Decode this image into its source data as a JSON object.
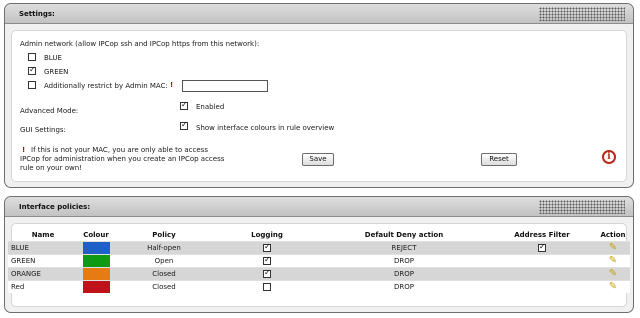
{
  "settings": {
    "title": "Settings:",
    "admin_network_label": "Admin network (allow IPCop ssh and IPCop https from this network):",
    "options": [
      {
        "label": "BLUE",
        "checked": false
      },
      {
        "label": "GREEN",
        "checked": true
      }
    ],
    "restrict_mac": {
      "label": "Additionally restrict by Admin MAC:",
      "checked": false,
      "error_mark": "!",
      "value": "",
      "placeholder": ""
    },
    "advanced_mode": {
      "label": "Advanced Mode:",
      "option_label": "Enabled",
      "checked": true
    },
    "gui_settings": {
      "label": "GUI Settings:",
      "option_label": "Show interface colours in rule overview",
      "checked": true
    },
    "warning": {
      "mark": "!",
      "line1": "If this is not your MAC, you are only able to access",
      "line2": "IPCop for administration when you create an IPCop access",
      "line3": "rule on your own!"
    },
    "save_label": "Save",
    "reset_label": "Reset",
    "info_glyph": "i",
    "info_icon": "info-icon"
  },
  "policies": {
    "title": "Interface policies:",
    "headers": {
      "name": "Name",
      "colour": "Colour",
      "policy": "Policy",
      "logging": "Logging",
      "default_deny": "Default Deny action",
      "address_filter": "Address Filter",
      "action": "Action"
    },
    "rows": [
      {
        "name": "BLUE",
        "colour": "#1f5fc8",
        "policy": "Half-open",
        "logging": true,
        "default_deny": "REJECT",
        "address_filter": true
      },
      {
        "name": "GREEN",
        "colour": "#0e9a12",
        "policy": "Open",
        "logging": true,
        "default_deny": "DROP",
        "address_filter": false
      },
      {
        "name": "ORANGE",
        "colour": "#e87a12",
        "policy": "Closed",
        "logging": true,
        "default_deny": "DROP",
        "address_filter": false
      },
      {
        "name": "Red",
        "colour": "#c0121a",
        "policy": "Closed",
        "logging": false,
        "default_deny": "DROP",
        "address_filter": false
      }
    ],
    "edit_icon": "pencil-icon"
  }
}
